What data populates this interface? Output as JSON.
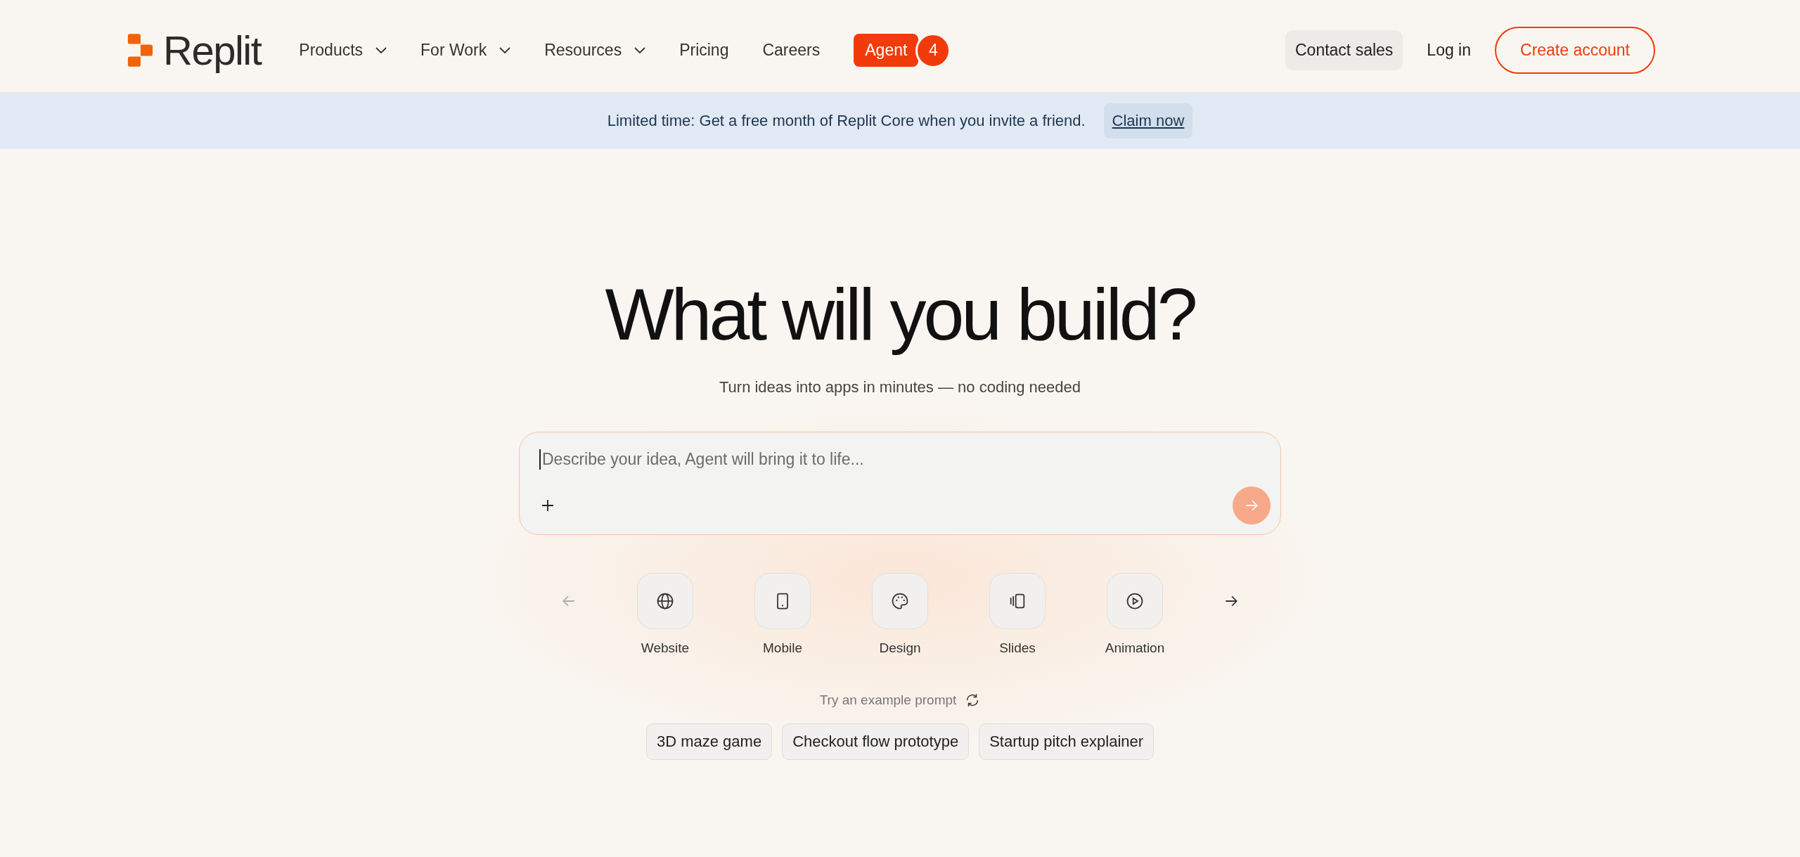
{
  "header": {
    "logo_text": "Replit",
    "nav": [
      {
        "label": "Products",
        "has_menu": true
      },
      {
        "label": "For Work",
        "has_menu": true
      },
      {
        "label": "Resources",
        "has_menu": true
      },
      {
        "label": "Pricing",
        "has_menu": false
      },
      {
        "label": "Careers",
        "has_menu": false
      }
    ],
    "agent": {
      "label": "Agent",
      "badge": "4"
    },
    "contact_sales": "Contact sales",
    "log_in": "Log in",
    "create_account": "Create account"
  },
  "banner": {
    "text": "Limited time: Get a free month of Replit Core when you invite a friend.",
    "link": "Claim now"
  },
  "hero": {
    "title": "What will you build?",
    "subtitle": "Turn ideas into apps in minutes — no coding needed"
  },
  "prompt_box": {
    "placeholder": "Describe your idea, Agent will bring it to life..."
  },
  "carousel": {
    "prev_disabled": true,
    "next_disabled": false,
    "categories": [
      {
        "label": "Website"
      },
      {
        "label": "Mobile"
      },
      {
        "label": "Design"
      },
      {
        "label": "Slides"
      },
      {
        "label": "Animation"
      }
    ]
  },
  "examples": {
    "label": "Try an example prompt",
    "prompts": [
      "3D maze game",
      "Checkout flow prototype",
      "Startup pitch explainer"
    ]
  }
}
